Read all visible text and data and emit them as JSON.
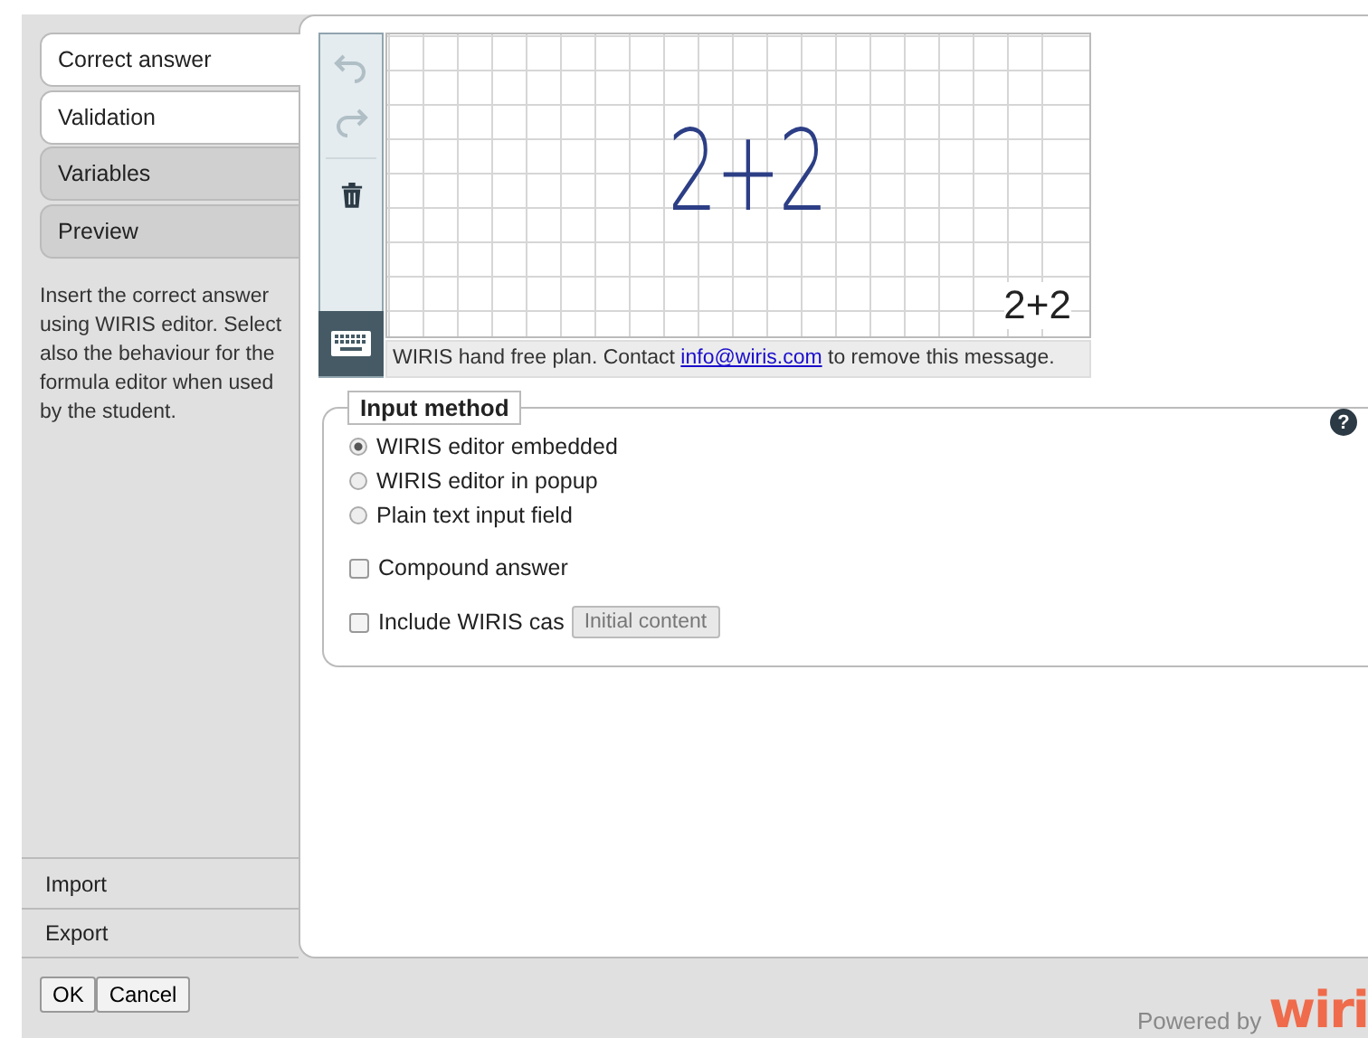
{
  "tabs": [
    {
      "label": "Correct answer",
      "selected": true,
      "enabled": true
    },
    {
      "label": "Validation",
      "selected": false,
      "enabled": true
    },
    {
      "label": "Variables",
      "selected": false,
      "enabled": false
    },
    {
      "label": "Preview",
      "selected": false,
      "enabled": false
    }
  ],
  "description": "Insert the correct answer using WIRIS editor. Select also the behaviour for the formula editor when used by the student.",
  "side_actions": [
    "Import",
    "Export"
  ],
  "editor": {
    "handwriting": "2+2",
    "recognized": "2+2",
    "undo_enabled": false,
    "redo_enabled": false,
    "notice_before": "WIRIS hand free plan. Contact ",
    "notice_link": "info@wiris.com",
    "notice_after": " to remove this message."
  },
  "input_method": {
    "legend": "Input method",
    "help": "?",
    "options": [
      {
        "label": "WIRIS editor embedded",
        "selected": true
      },
      {
        "label": "WIRIS editor in popup",
        "selected": false
      },
      {
        "label": "Plain text input field",
        "selected": false
      }
    ],
    "compound": {
      "label": "Compound answer",
      "checked": false
    },
    "cas": {
      "label": "Include WIRIS cas",
      "checked": false,
      "button": "Initial content"
    }
  },
  "buttons": [
    "OK",
    "Cancel"
  ],
  "footer": {
    "powered": "Powered by",
    "logo": "wiri"
  }
}
